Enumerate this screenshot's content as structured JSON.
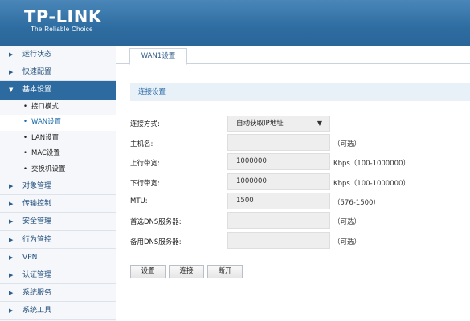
{
  "header": {
    "logo_main": "TP-LINK",
    "logo_tagline": "The Reliable Choice",
    "background_color": "#2e6da1"
  },
  "sidebar": {
    "items": [
      {
        "label": "运行状态",
        "icon": "arrow-right-icon"
      },
      {
        "label": "快速配置",
        "icon": "arrow-right-icon"
      },
      {
        "label": "基本设置",
        "icon": "arrow-down-icon",
        "expanded": true,
        "children": [
          {
            "label": "接口模式"
          },
          {
            "label": "WAN设置",
            "selected": true
          },
          {
            "label": "LAN设置"
          },
          {
            "label": "MAC设置"
          },
          {
            "label": "交换机设置"
          }
        ]
      },
      {
        "label": "对象管理",
        "icon": "arrow-right-icon"
      },
      {
        "label": "传输控制",
        "icon": "arrow-right-icon"
      },
      {
        "label": "安全管理",
        "icon": "arrow-right-icon"
      },
      {
        "label": "行为管控",
        "icon": "arrow-right-icon"
      },
      {
        "label": "VPN",
        "icon": "arrow-right-icon"
      },
      {
        "label": "认证管理",
        "icon": "arrow-right-icon"
      },
      {
        "label": "系统服务",
        "icon": "arrow-right-icon"
      },
      {
        "label": "系统工具",
        "icon": "arrow-right-icon"
      }
    ]
  },
  "main": {
    "tab_label": "WAN1设置",
    "section_title": "连接设置",
    "form": {
      "connection_type": {
        "label": "连接方式:",
        "value": "自动获取IP地址"
      },
      "hostname": {
        "label": "主机名:",
        "value": "",
        "hint": "（可选）"
      },
      "upload_bandwidth": {
        "label": "上行带宽:",
        "value": "1000000",
        "hint": "Kbps（100-1000000）"
      },
      "download_bandwidth": {
        "label": "下行带宽:",
        "value": "1000000",
        "hint": "Kbps（100-1000000）"
      },
      "mtu": {
        "label": "MTU:",
        "value": "1500",
        "hint": "（576-1500）"
      },
      "primary_dns": {
        "label": "首选DNS服务器:",
        "value": "",
        "hint": "（可选）"
      },
      "secondary_dns": {
        "label": "备用DNS服务器:",
        "value": "",
        "hint": "（可选）"
      }
    },
    "buttons": {
      "settings_label": "设置",
      "connect_label": "连接",
      "disconnect_label": "断开"
    }
  },
  "colors": {
    "accent": "#2d6a9f",
    "section_bg": "#e9f1f8",
    "link_text": "#1a6aaa"
  }
}
